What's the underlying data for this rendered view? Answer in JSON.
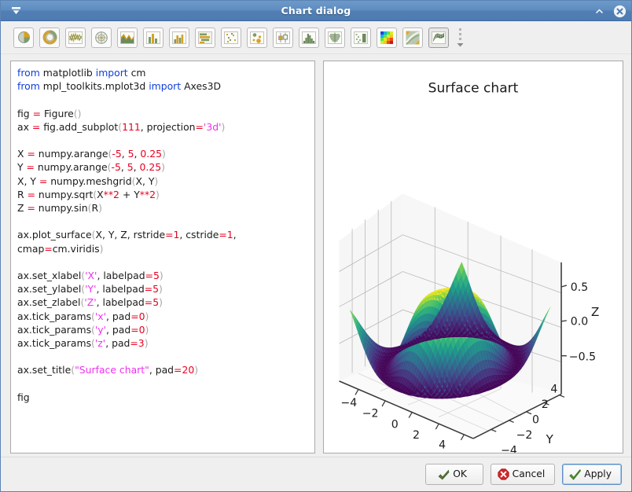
{
  "window": {
    "title": "Chart dialog",
    "titlebar_left_icon": "double-chevron-down-icon",
    "shade_button_icon": "chevron-up-icon",
    "close_button_icon": "close-circle-icon",
    "title_bar_color": "#5e8cbf"
  },
  "toolbar": {
    "overflow_icon": "toolbar-overflow-icon",
    "items": [
      {
        "name": "pie-chart",
        "tooltip": "Pie chart"
      },
      {
        "name": "donut-chart",
        "tooltip": "Donut chart"
      },
      {
        "name": "line-chart",
        "tooltip": "Line chart"
      },
      {
        "name": "radar-chart",
        "tooltip": "Radar chart"
      },
      {
        "name": "area-chart",
        "tooltip": "Area chart"
      },
      {
        "name": "bar-chart",
        "tooltip": "Bar chart"
      },
      {
        "name": "grouped-bar-chart",
        "tooltip": "Grouped bar chart"
      },
      {
        "name": "horizontal-bar-chart",
        "tooltip": "Horizontal bar chart"
      },
      {
        "name": "scatter-chart",
        "tooltip": "Scatter chart"
      },
      {
        "name": "bubble-chart",
        "tooltip": "Bubble chart"
      },
      {
        "name": "box-plot-chart",
        "tooltip": "Box plot"
      },
      {
        "name": "histogram-chart",
        "tooltip": "Histogram"
      },
      {
        "name": "violin-chart",
        "tooltip": "Violin plot"
      },
      {
        "name": "step-chart",
        "tooltip": "Step chart"
      },
      {
        "name": "heatmap-chart",
        "tooltip": "Heatmap"
      },
      {
        "name": "contour-chart",
        "tooltip": "Contour chart"
      },
      {
        "name": "surface-chart",
        "tooltip": "Surface chart",
        "selected": true
      }
    ]
  },
  "editor": {
    "lines": [
      "from matplotlib import cm",
      "from mpl_toolkits.mplot3d import Axes3D",
      "",
      "fig = Figure()",
      "ax = fig.add_subplot(111, projection='3d')",
      "",
      "X = numpy.arange(-5, 5, 0.25)",
      "Y = numpy.arange(-5, 5, 0.25)",
      "X, Y = numpy.meshgrid(X, Y)",
      "R = numpy.sqrt(X**2 + Y**2)",
      "Z = numpy.sin(R)",
      "",
      "ax.plot_surface(X, Y, Z, rstride=1, cstride=1,",
      "cmap=cm.viridis)",
      "",
      "ax.set_xlabel('X', labelpad=5)",
      "ax.set_ylabel('Y', labelpad=5)",
      "ax.set_zlabel('Z', labelpad=5)",
      "ax.tick_params('x', pad=0)",
      "ax.tick_params('y', pad=0)",
      "ax.tick_params('z', pad=3)",
      "",
      "ax.set_title(\"Surface chart\", pad=20)",
      "",
      "fig"
    ]
  },
  "chart_data": {
    "type": "surface",
    "title": "Surface chart",
    "xlabel": "X",
    "ylabel": "Y",
    "zlabel": "Z",
    "xticks": [
      "-4",
      "-2",
      "0",
      "2",
      "4"
    ],
    "yticks": [
      "-4",
      "-2",
      "0",
      "2",
      "4"
    ],
    "zticks": [
      "-0.5",
      "0.0",
      "0.5"
    ],
    "xlim": [
      -5,
      5
    ],
    "ylim": [
      -5,
      5
    ],
    "zlim": [
      -1,
      1
    ],
    "colormap": "viridis",
    "function": "Z = sin(sqrt(X**2 + Y**2))",
    "grid": true,
    "legend": false,
    "rstride": 1,
    "cstride": 1,
    "step": 0.25
  },
  "footer": {
    "ok_label": "OK",
    "cancel_label": "Cancel",
    "apply_label": "Apply"
  }
}
